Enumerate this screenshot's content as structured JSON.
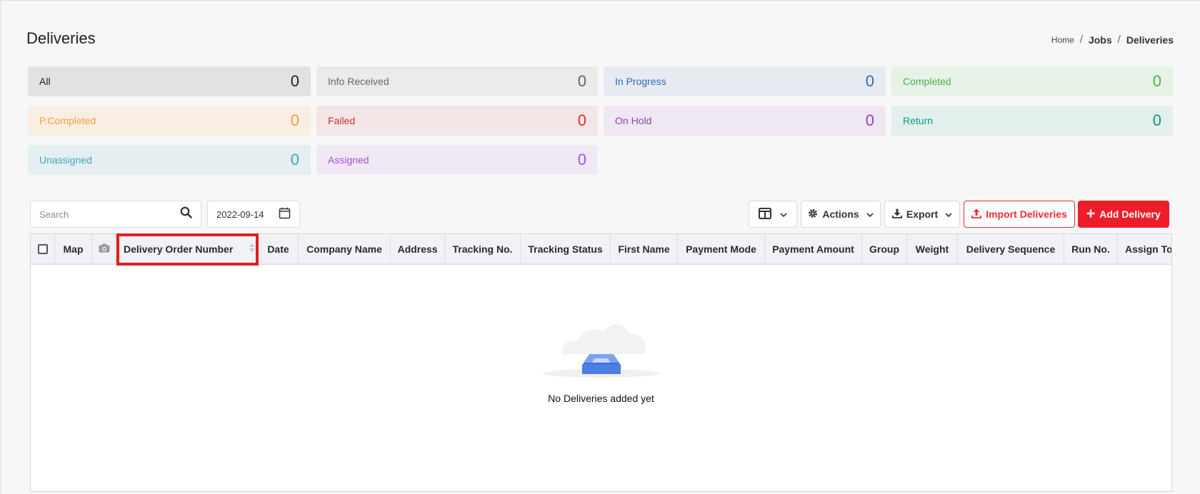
{
  "page": {
    "title": "Deliveries"
  },
  "breadcrumb": {
    "home": "Home",
    "jobs": "Jobs",
    "current": "Deliveries"
  },
  "status_tiles": [
    {
      "label": "All",
      "count": "0",
      "text_color": "#222222",
      "bg": "#e2e2e2"
    },
    {
      "label": "Info Received",
      "count": "0",
      "text_color": "#666666",
      "bg": "#ebebeb"
    },
    {
      "label": "In Progress",
      "count": "0",
      "text_color": "#2b6fb8",
      "bg": "#e6ebf2"
    },
    {
      "label": "Completed",
      "count": "0",
      "text_color": "#4caf50",
      "bg": "#e6f2e6"
    },
    {
      "label": "P.Completed",
      "count": "0",
      "text_color": "#f2a13a",
      "bg": "#f9eee2"
    },
    {
      "label": "Failed",
      "count": "0",
      "text_color": "#d32f2f",
      "bg": "#f4e6e6"
    },
    {
      "label": "On Hold",
      "count": "0",
      "text_color": "#8e44ad",
      "bg": "#efe7f1"
    },
    {
      "label": "Return",
      "count": "0",
      "text_color": "#0e9486",
      "bg": "#e2efec"
    },
    {
      "label": "Unassigned",
      "count": "0",
      "text_color": "#42a5c7",
      "bg": "#e5eef0"
    },
    {
      "label": "Assigned",
      "count": "0",
      "text_color": "#a84fd8",
      "bg": "#f1e8f6"
    }
  ],
  "toolbar": {
    "search_placeholder": "Search",
    "date_value": "2022-09-14",
    "actions_label": "Actions",
    "export_label": "Export",
    "import_label": "Import Deliveries",
    "add_label": "Add Delivery"
  },
  "table": {
    "columns": [
      "Map",
      "Delivery Order Number",
      "Date",
      "Company Name",
      "Address",
      "Tracking No.",
      "Tracking Status",
      "First Name",
      "Payment Mode",
      "Payment Amount",
      "Group",
      "Weight",
      "Delivery Sequence",
      "Run No.",
      "Assign To"
    ],
    "empty_message": "No Deliveries added yet"
  },
  "colors": {
    "accent_red": "#ee1d2c",
    "highlight_red": "#e02020"
  },
  "icons": [
    "search-icon",
    "calendar-icon",
    "camera-icon",
    "columns-icon",
    "gear-icon",
    "download-icon",
    "upload-icon",
    "plus-icon",
    "chevron-down-icon",
    "empty-inbox-icon"
  ]
}
